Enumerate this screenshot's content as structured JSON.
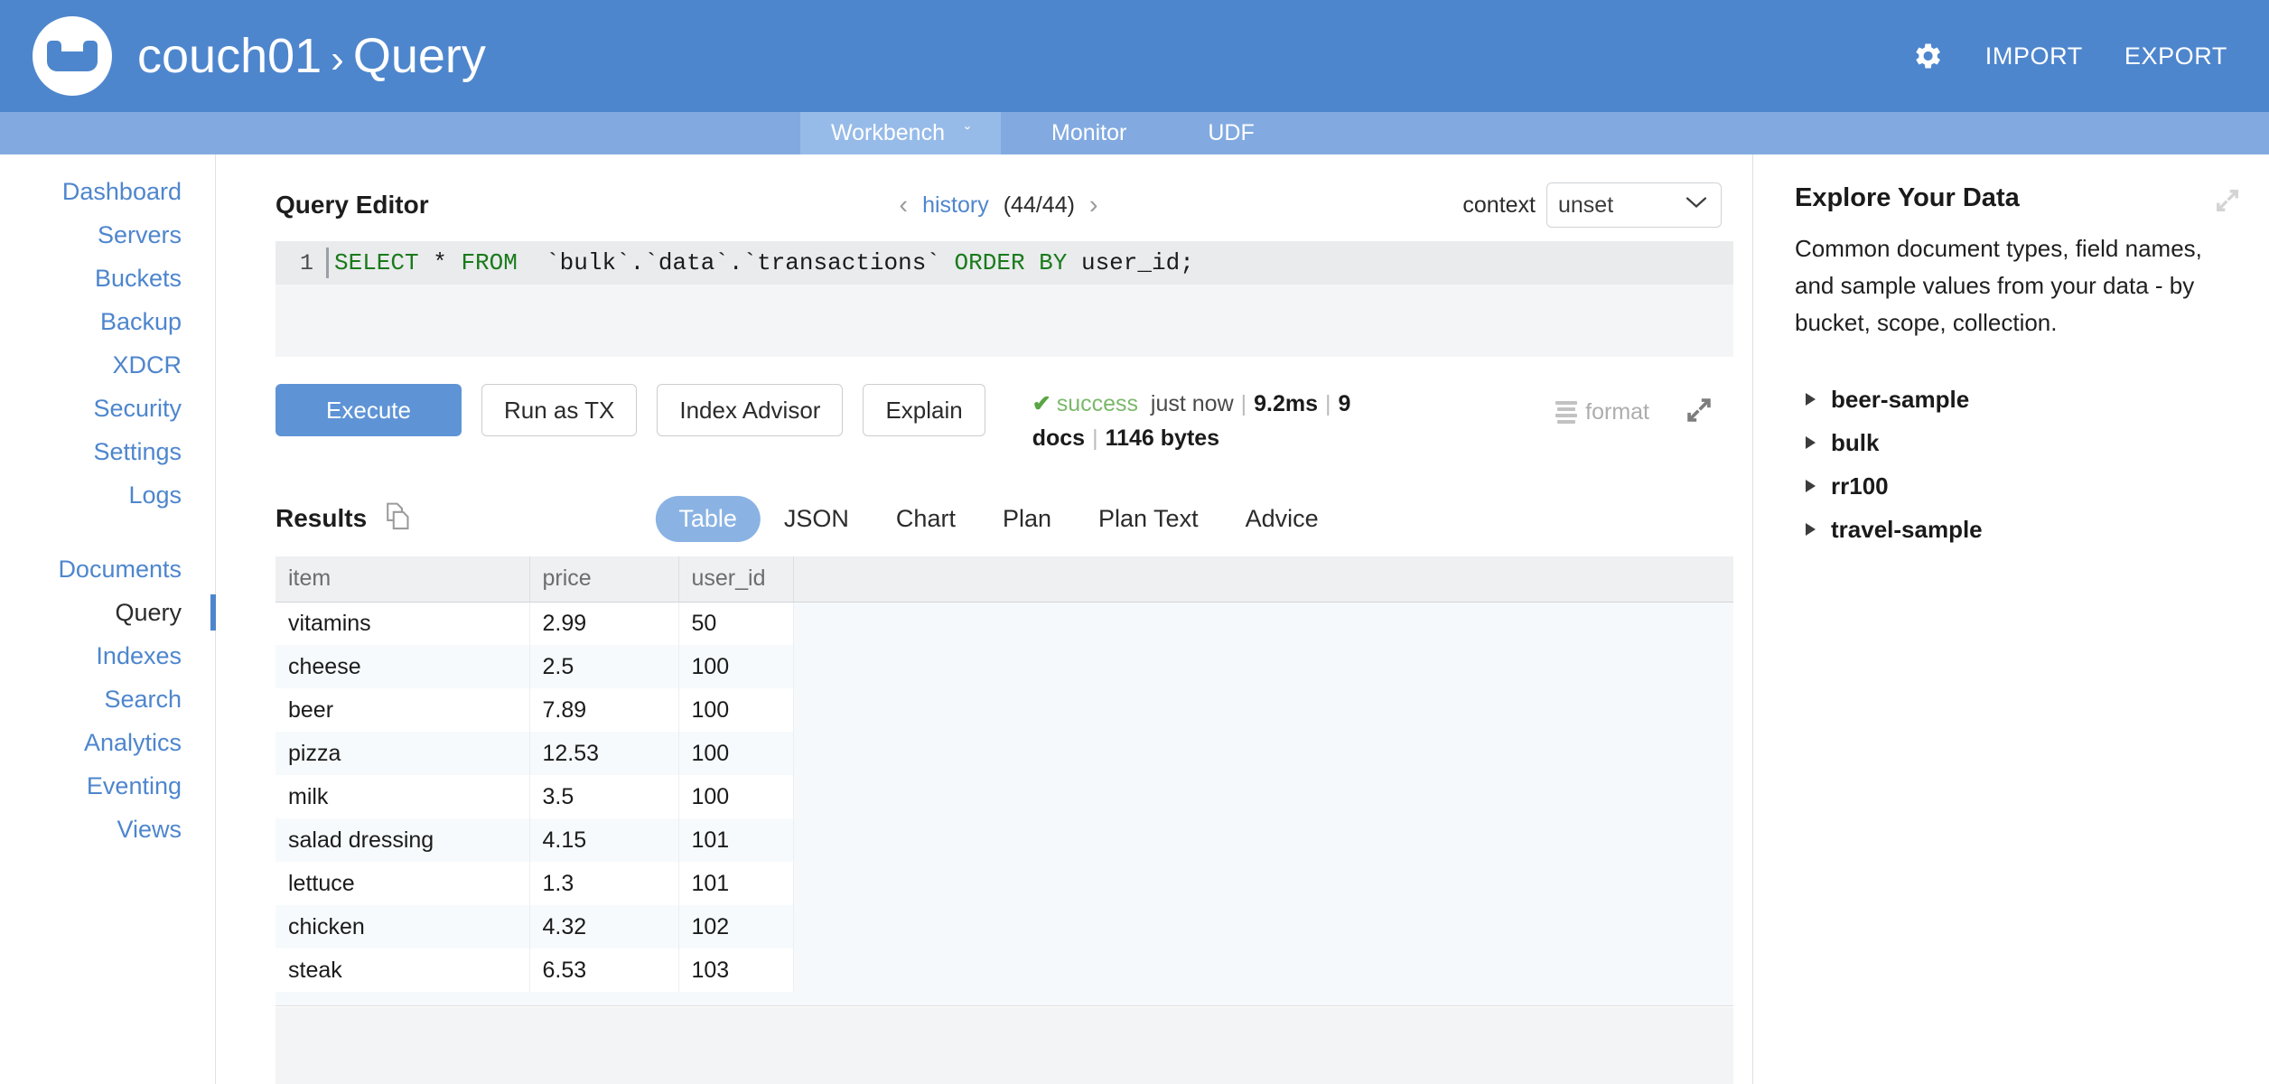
{
  "header": {
    "logo_icon": "couchbase-logo-icon",
    "cluster": "couch01",
    "separator": "›",
    "section": "Query",
    "gear_icon": "gear-icon",
    "import_label": "IMPORT",
    "export_label": "EXPORT"
  },
  "subnav": {
    "items": [
      {
        "label": "Workbench",
        "active": true,
        "chevron": "ˇ"
      },
      {
        "label": "Monitor",
        "active": false
      },
      {
        "label": "UDF",
        "active": false
      }
    ]
  },
  "sidebar": {
    "group1": [
      {
        "label": "Dashboard"
      },
      {
        "label": "Servers"
      },
      {
        "label": "Buckets"
      },
      {
        "label": "Backup"
      },
      {
        "label": "XDCR"
      },
      {
        "label": "Security"
      },
      {
        "label": "Settings"
      },
      {
        "label": "Logs"
      }
    ],
    "group2": [
      {
        "label": "Documents"
      },
      {
        "label": "Query"
      },
      {
        "label": "Indexes"
      },
      {
        "label": "Search"
      },
      {
        "label": "Analytics"
      },
      {
        "label": "Eventing"
      },
      {
        "label": "Views"
      }
    ],
    "active": "Query"
  },
  "editor": {
    "title": "Query Editor",
    "history_prev_icon": "‹",
    "history_label": "history",
    "history_count": "(44/44)",
    "history_next_icon": "›",
    "context_label": "context",
    "context_value": "unset",
    "context_options": [
      "unset"
    ],
    "line_number": "1",
    "sql_tokens": [
      {
        "text": "SELECT",
        "kw": true
      },
      {
        "text": " * ",
        "kw": false
      },
      {
        "text": "FROM",
        "kw": true
      },
      {
        "text": "  `bulk`.`data`.`transactions` ",
        "kw": false
      },
      {
        "text": "ORDER BY",
        "kw": true
      },
      {
        "text": " user_id;",
        "kw": false
      }
    ],
    "sql_full": "SELECT * FROM  `bulk`.`data`.`transactions` ORDER BY user_id;"
  },
  "actions": {
    "execute": "Execute",
    "run_as_tx": "Run as TX",
    "index_advisor": "Index Advisor",
    "explain": "Explain",
    "format": "format",
    "format_icon": "format-lines-icon",
    "expand_icon": "expand-arrows-icon"
  },
  "status": {
    "check_icon": "✔",
    "state": "success",
    "time_ago": "just now",
    "duration": "9.2ms",
    "docs": "9 docs",
    "size": "1146 bytes",
    "separator": "|"
  },
  "results": {
    "title": "Results",
    "copy_icon": "copy-icon",
    "tabs": [
      {
        "label": "Table",
        "active": true
      },
      {
        "label": "JSON",
        "active": false
      },
      {
        "label": "Chart",
        "active": false
      },
      {
        "label": "Plan",
        "active": false
      },
      {
        "label": "Plan Text",
        "active": false
      },
      {
        "label": "Advice",
        "active": false
      }
    ],
    "columns": [
      "item",
      "price",
      "user_id"
    ],
    "rows": [
      {
        "item": "vitamins",
        "price": "2.99",
        "user_id": "50"
      },
      {
        "item": "cheese",
        "price": "2.5",
        "user_id": "100"
      },
      {
        "item": "beer",
        "price": "7.89",
        "user_id": "100"
      },
      {
        "item": "pizza",
        "price": "12.53",
        "user_id": "100"
      },
      {
        "item": "milk",
        "price": "3.5",
        "user_id": "100"
      },
      {
        "item": "salad dressing",
        "price": "4.15",
        "user_id": "101"
      },
      {
        "item": "lettuce",
        "price": "1.3",
        "user_id": "101"
      },
      {
        "item": "chicken",
        "price": "4.32",
        "user_id": "102"
      },
      {
        "item": "steak",
        "price": "6.53",
        "user_id": "103"
      }
    ]
  },
  "right_panel": {
    "title": "Explore Your Data",
    "description": "Common document types, field names, and sample values from your data - by bucket, scope, collection.",
    "expand_icon": "expand-arrows-icon",
    "buckets": [
      {
        "label": "beer-sample"
      },
      {
        "label": "bulk"
      },
      {
        "label": "rr100"
      },
      {
        "label": "travel-sample"
      }
    ]
  },
  "colors": {
    "header_blue": "#4e86cd",
    "subnav_blue": "#82aae0",
    "subnav_active": "#97bbe8",
    "link_blue": "#4e86cd",
    "primary_button": "#5e94d6",
    "tab_active": "#8ab3e4",
    "success_green": "#7bb86a",
    "sql_keyword_green": "#1a7a1a"
  }
}
